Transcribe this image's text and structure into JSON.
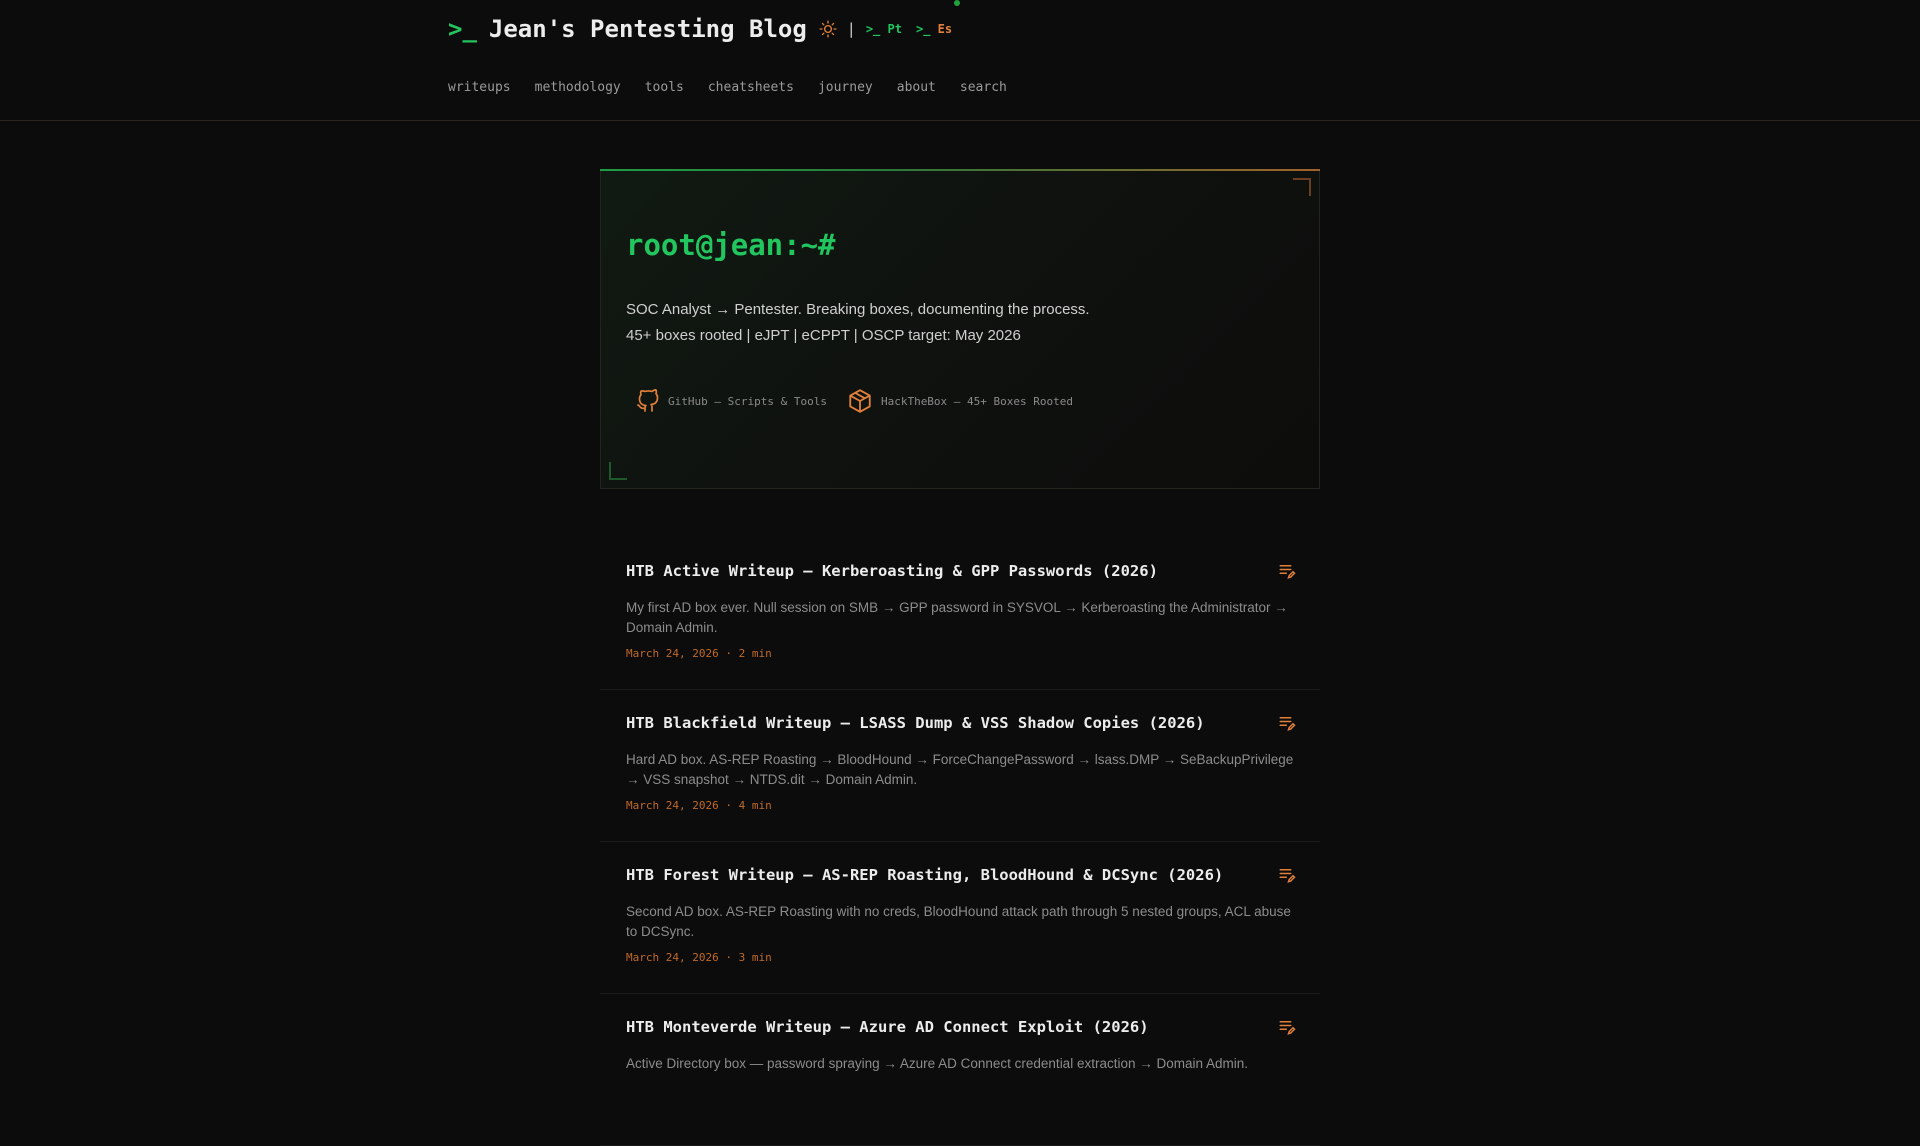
{
  "header": {
    "prompt": ">_",
    "title": "Jean's Pentesting Blog",
    "separator": "|",
    "languages": [
      {
        "prefix": ">_",
        "code": "Pt"
      },
      {
        "prefix": ">_",
        "code": "Es"
      }
    ],
    "theme_icon": "sun-icon"
  },
  "nav": {
    "items": [
      "writeups",
      "methodology",
      "tools",
      "cheatsheets",
      "journey",
      "about",
      "search"
    ]
  },
  "hero": {
    "prompt": "root@jean:~#",
    "line1": "SOC Analyst → Pentester. Breaking boxes, documenting the process.",
    "line2": "45+ boxes rooted | eJPT | eCPPT | OSCP target: May 2026",
    "links": [
      {
        "icon": "github-icon",
        "label": "GitHub — Scripts & Tools"
      },
      {
        "icon": "box-icon",
        "label": "HackTheBox — 45+ Boxes Rooted"
      }
    ]
  },
  "posts": [
    {
      "title": "HTB Active Writeup — Kerberoasting & GPP Passwords (2026)",
      "description": "My first AD box ever. Null session on SMB → GPP password in SYSVOL → Kerberoasting the Administrator → Domain Admin.",
      "meta": "March 24, 2026 · 2 min",
      "icon": "edit-list-icon"
    },
    {
      "title": "HTB Blackfield Writeup — LSASS Dump & VSS Shadow Copies (2026)",
      "description": "Hard AD box. AS-REP Roasting → BloodHound → ForceChangePassword → lsass.DMP → SeBackupPrivilege → VSS snapshot → NTDS.dit → Domain Admin.",
      "meta": "March 24, 2026 · 4 min",
      "icon": "edit-list-icon"
    },
    {
      "title": "HTB Forest Writeup — AS-REP Roasting, BloodHound & DCSync (2026)",
      "description": "Second AD box. AS-REP Roasting with no creds, BloodHound attack path through 5 nested groups, ACL abuse to DCSync.",
      "meta": "March 24, 2026 · 3 min",
      "icon": "edit-list-icon"
    },
    {
      "title": "HTB Monteverde Writeup — Azure AD Connect Exploit (2026)",
      "description": "Active Directory box — password spraying → Azure AD Connect credential extraction → Domain Admin.",
      "meta": "",
      "icon": "edit-list-icon"
    }
  ],
  "colors": {
    "background": "#0c0c0c",
    "accent_green": "#22c55e",
    "accent_orange": "#e0803a"
  }
}
